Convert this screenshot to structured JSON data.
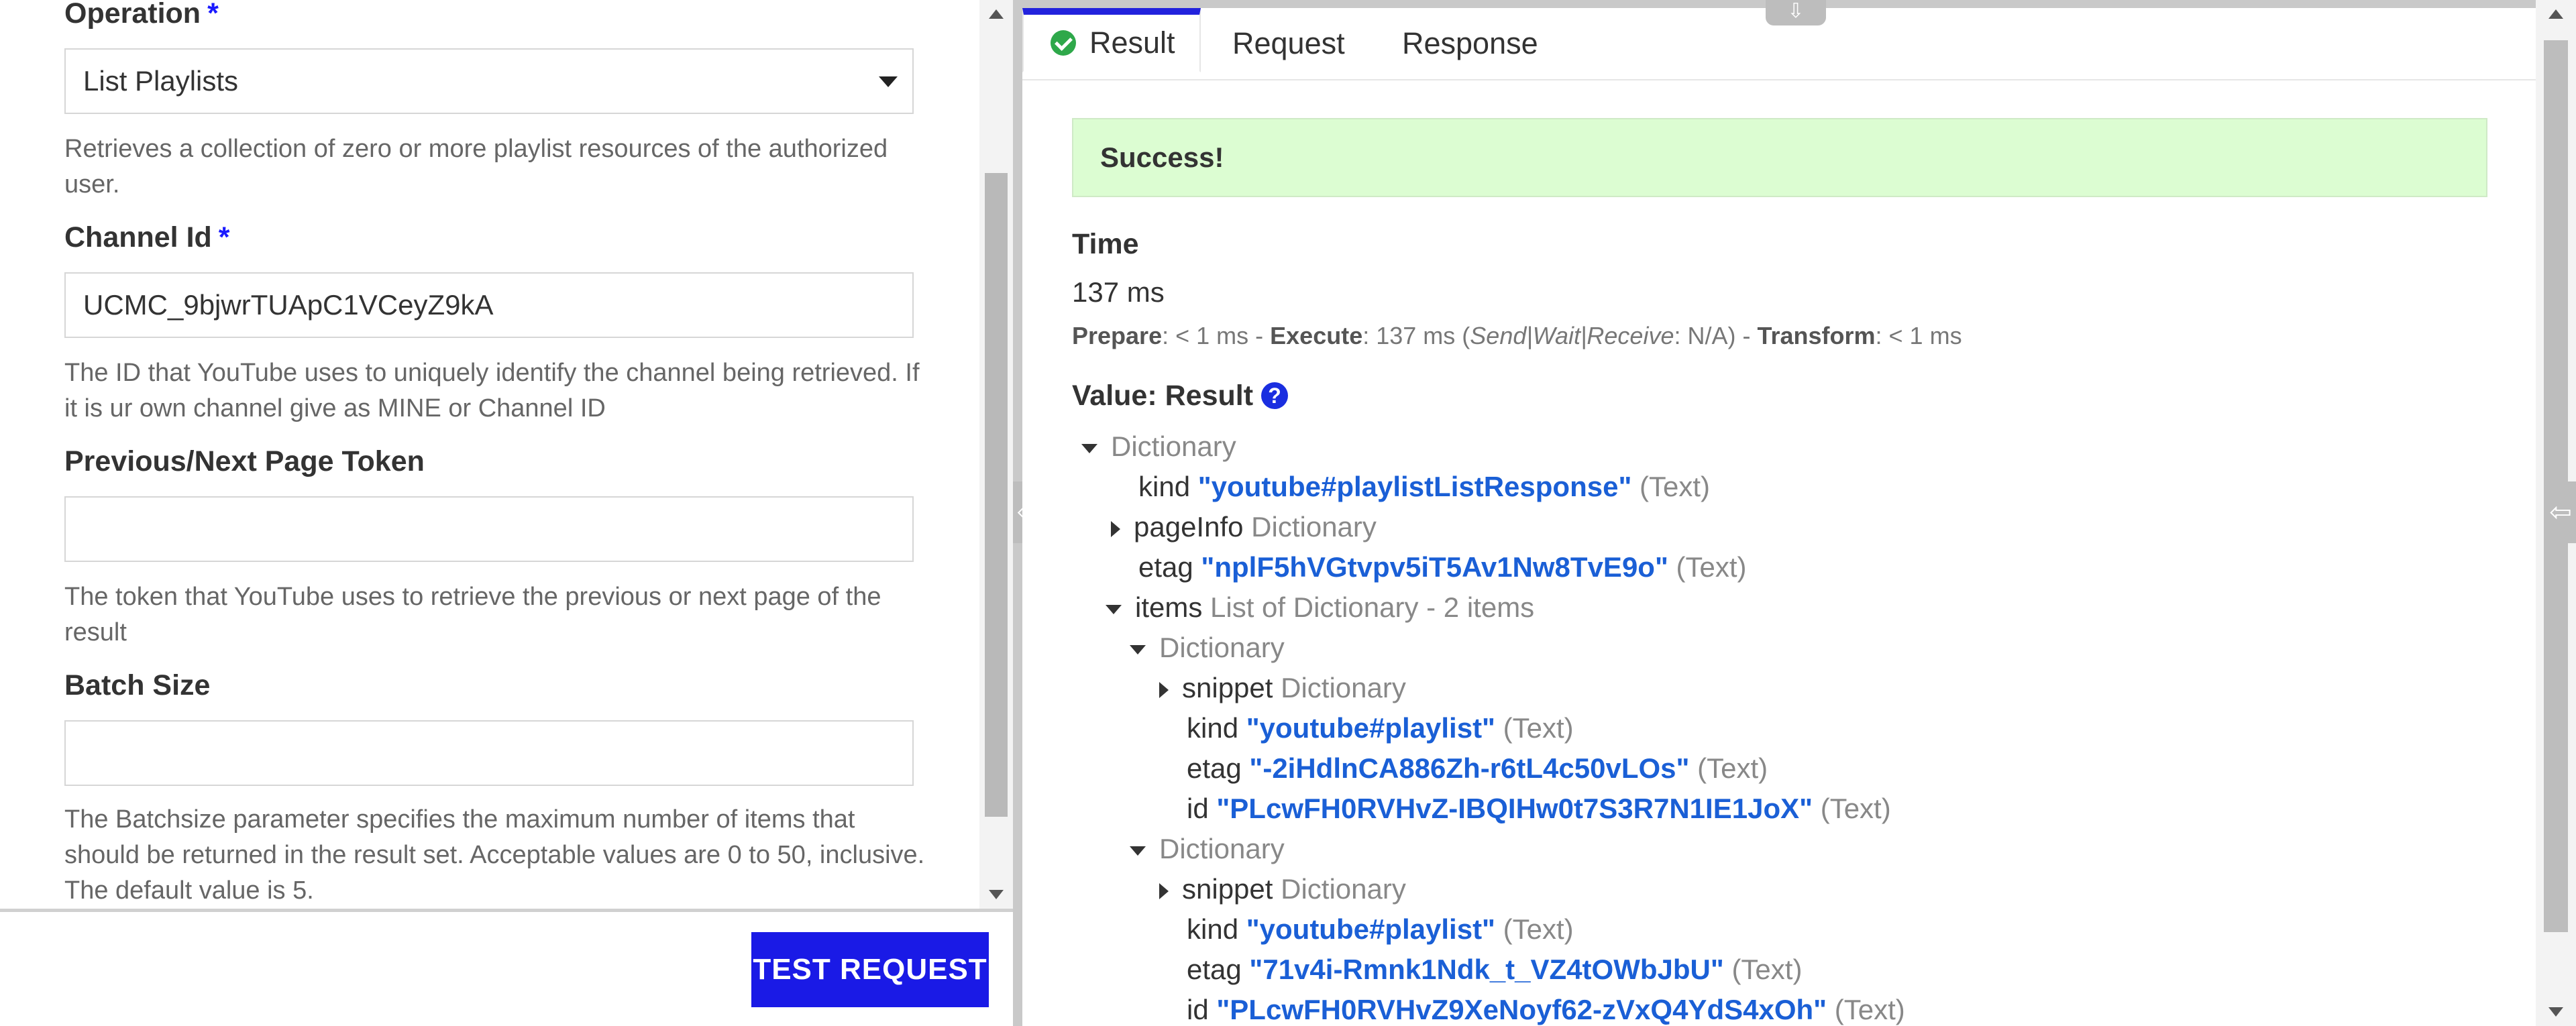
{
  "form": {
    "operation": {
      "label": "Operation",
      "required": "*",
      "value": "List Playlists",
      "help": "Retrieves a collection of zero or more playlist resources of the authorized user."
    },
    "channel_id": {
      "label": "Channel Id",
      "required": "*",
      "value": "UCMC_9bjwrTUApC1VCeyZ9kA",
      "help": "The ID that YouTube uses to uniquely identify the channel being retrieved. If it is ur own channel give as MINE or Channel ID"
    },
    "page_token": {
      "label": "Previous/Next Page Token",
      "value": "",
      "help": "The token that YouTube uses to retrieve the previous or next page of the result"
    },
    "batch_size": {
      "label": "Batch Size",
      "value": "",
      "help": "The Batchsize parameter specifies the maximum number of items that should be returned in the result set. Acceptable values are 0 to 50, inclusive. The default value is 5."
    },
    "test_button": "TEST REQUEST"
  },
  "tabs": [
    {
      "label": "Result",
      "active": true,
      "icon": "check-circle-icon"
    },
    {
      "label": "Request"
    },
    {
      "label": "Response"
    }
  ],
  "result": {
    "banner": "Success!",
    "time_heading": "Time",
    "time_value": "137 ms",
    "timing": {
      "prepare_label": "Prepare",
      "prepare_value": ": < 1 ms - ",
      "execute_label": "Execute",
      "execute_value": ": 137 ms (",
      "breakdown_label": "Send|Wait|Receive",
      "breakdown_value": ": N/A) - ",
      "transform_label": "Transform",
      "transform_value": ": < 1 ms"
    },
    "value_heading": "Value: Result",
    "help_icon": "?"
  },
  "tree": [
    {
      "toggle": "down",
      "key": "",
      "value": "",
      "type": "Dictionary"
    },
    {
      "toggle": "",
      "key": "kind",
      "value": "\"youtube#playlistListResponse\"",
      "type": "(Text)"
    },
    {
      "toggle": "right",
      "key": "pageInfo",
      "value": "",
      "type": "Dictionary"
    },
    {
      "toggle": "",
      "key": "etag",
      "value": "\"nplF5hVGtvpv5iT5Av1Nw8TvE9o\"",
      "type": "(Text)"
    },
    {
      "toggle": "down",
      "key": "items",
      "value": "",
      "type": "List of Dictionary - 2 items"
    },
    {
      "toggle": "down",
      "key": "",
      "value": "",
      "type": "Dictionary"
    },
    {
      "toggle": "right",
      "key": "snippet",
      "value": "",
      "type": "Dictionary"
    },
    {
      "toggle": "",
      "key": "kind",
      "value": "\"youtube#playlist\"",
      "type": "(Text)"
    },
    {
      "toggle": "",
      "key": "etag",
      "value": "\"-2iHdlnCA886Zh-r6tL4c50vLOs\"",
      "type": "(Text)"
    },
    {
      "toggle": "",
      "key": "id",
      "value": "\"PLcwFH0RVHvZ-IBQIHw0t7S3R7N1IE1JoX\"",
      "type": "(Text)"
    },
    {
      "toggle": "down",
      "key": "",
      "value": "",
      "type": "Dictionary"
    },
    {
      "toggle": "right",
      "key": "snippet",
      "value": "",
      "type": "Dictionary"
    },
    {
      "toggle": "",
      "key": "kind",
      "value": "\"youtube#playlist\"",
      "type": "(Text)"
    },
    {
      "toggle": "",
      "key": "etag",
      "value": "\"71v4i-Rmnk1Ndk_t_VZ4tOWbJbU\"",
      "type": "(Text)"
    },
    {
      "toggle": "",
      "key": "id",
      "value": "\"PLcwFH0RVHvZ9XeNoyf62-zVxQ4YdS4xOh\"",
      "type": "(Text)"
    }
  ],
  "icons": {
    "splitter_left": "arrow-left-icon",
    "splitter_right": "arrow-left-icon",
    "collapse": "arrow-down-icon"
  }
}
